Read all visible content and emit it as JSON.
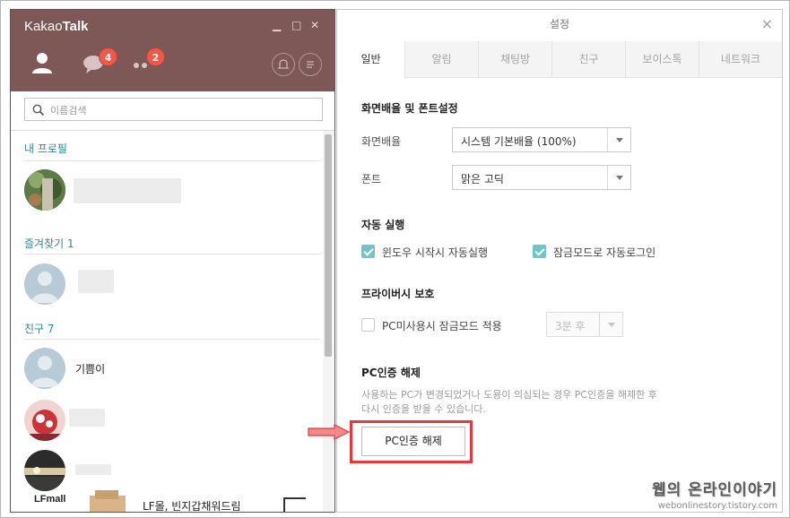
{
  "kakao": {
    "app_name_regular": "Kakao",
    "app_name_bold": "Talk",
    "window_controls": {
      "minimize": "▁",
      "maximize": "□",
      "close": "✕"
    },
    "nav": {
      "chats_badge": "4",
      "more_badge": "2"
    },
    "search_placeholder": "이름검색",
    "sections": {
      "my_profile": "내 프로필",
      "favorites": "즐겨찾기 1",
      "friends": "친구 7"
    },
    "friends_visible": [
      "기쁨이"
    ],
    "ad": {
      "logo": "LFmall",
      "text": "LF몰, 빈지갑채워드림"
    }
  },
  "settings": {
    "title": "설정",
    "close": "×",
    "tabs": [
      "일반",
      "알림",
      "채팅방",
      "친구",
      "보이스톡",
      "네트워크"
    ],
    "active_tab": "일반",
    "display": {
      "heading": "화면배율 및 폰트설정",
      "scale_label": "화면배율",
      "scale_value": "시스템 기본배율 (100%)",
      "font_label": "폰트",
      "font_value": "맑은 고딕"
    },
    "autorun": {
      "heading": "자동 실행",
      "windows_start": "윈도우 시작시 자동실행",
      "lock_login": "잠금모드로 자동로그인"
    },
    "privacy": {
      "heading": "프라이버시 보호",
      "idle_lock": "PC미사용시 잠금모드 적용",
      "idle_value": "3분 후"
    },
    "pc_auth": {
      "heading": "PC인증 해제",
      "desc1": "사용하는 PC가 변경되었거나 도용이 의심되는 경우 PC인증을 해제한 후",
      "desc2": "다시 인증을 받을 수 있습니다.",
      "button": "PC인증 해제"
    }
  },
  "watermark": {
    "title": "웹의 온라인이야기",
    "url": "webonlinestory.tistory.com"
  },
  "colors": {
    "kakao_header": "#7e5757",
    "accent_teal": "#6fc6c9",
    "badge_red": "#f0594a",
    "highlight_red": "#e8383d"
  }
}
